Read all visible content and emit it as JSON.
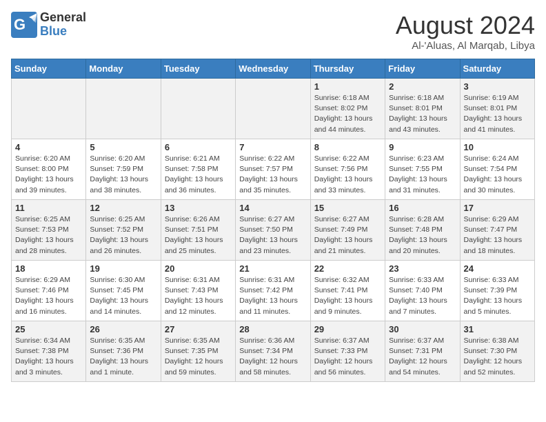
{
  "header": {
    "logo_line1": "General",
    "logo_line2": "Blue",
    "month": "August 2024",
    "location": "Al-'Aluas, Al Marqab, Libya"
  },
  "weekdays": [
    "Sunday",
    "Monday",
    "Tuesday",
    "Wednesday",
    "Thursday",
    "Friday",
    "Saturday"
  ],
  "weeks": [
    [
      {
        "day": "",
        "info": ""
      },
      {
        "day": "",
        "info": ""
      },
      {
        "day": "",
        "info": ""
      },
      {
        "day": "",
        "info": ""
      },
      {
        "day": "1",
        "info": "Sunrise: 6:18 AM\nSunset: 8:02 PM\nDaylight: 13 hours\nand 44 minutes."
      },
      {
        "day": "2",
        "info": "Sunrise: 6:18 AM\nSunset: 8:01 PM\nDaylight: 13 hours\nand 43 minutes."
      },
      {
        "day": "3",
        "info": "Sunrise: 6:19 AM\nSunset: 8:01 PM\nDaylight: 13 hours\nand 41 minutes."
      }
    ],
    [
      {
        "day": "4",
        "info": "Sunrise: 6:20 AM\nSunset: 8:00 PM\nDaylight: 13 hours\nand 39 minutes."
      },
      {
        "day": "5",
        "info": "Sunrise: 6:20 AM\nSunset: 7:59 PM\nDaylight: 13 hours\nand 38 minutes."
      },
      {
        "day": "6",
        "info": "Sunrise: 6:21 AM\nSunset: 7:58 PM\nDaylight: 13 hours\nand 36 minutes."
      },
      {
        "day": "7",
        "info": "Sunrise: 6:22 AM\nSunset: 7:57 PM\nDaylight: 13 hours\nand 35 minutes."
      },
      {
        "day": "8",
        "info": "Sunrise: 6:22 AM\nSunset: 7:56 PM\nDaylight: 13 hours\nand 33 minutes."
      },
      {
        "day": "9",
        "info": "Sunrise: 6:23 AM\nSunset: 7:55 PM\nDaylight: 13 hours\nand 31 minutes."
      },
      {
        "day": "10",
        "info": "Sunrise: 6:24 AM\nSunset: 7:54 PM\nDaylight: 13 hours\nand 30 minutes."
      }
    ],
    [
      {
        "day": "11",
        "info": "Sunrise: 6:25 AM\nSunset: 7:53 PM\nDaylight: 13 hours\nand 28 minutes."
      },
      {
        "day": "12",
        "info": "Sunrise: 6:25 AM\nSunset: 7:52 PM\nDaylight: 13 hours\nand 26 minutes."
      },
      {
        "day": "13",
        "info": "Sunrise: 6:26 AM\nSunset: 7:51 PM\nDaylight: 13 hours\nand 25 minutes."
      },
      {
        "day": "14",
        "info": "Sunrise: 6:27 AM\nSunset: 7:50 PM\nDaylight: 13 hours\nand 23 minutes."
      },
      {
        "day": "15",
        "info": "Sunrise: 6:27 AM\nSunset: 7:49 PM\nDaylight: 13 hours\nand 21 minutes."
      },
      {
        "day": "16",
        "info": "Sunrise: 6:28 AM\nSunset: 7:48 PM\nDaylight: 13 hours\nand 20 minutes."
      },
      {
        "day": "17",
        "info": "Sunrise: 6:29 AM\nSunset: 7:47 PM\nDaylight: 13 hours\nand 18 minutes."
      }
    ],
    [
      {
        "day": "18",
        "info": "Sunrise: 6:29 AM\nSunset: 7:46 PM\nDaylight: 13 hours\nand 16 minutes."
      },
      {
        "day": "19",
        "info": "Sunrise: 6:30 AM\nSunset: 7:45 PM\nDaylight: 13 hours\nand 14 minutes."
      },
      {
        "day": "20",
        "info": "Sunrise: 6:31 AM\nSunset: 7:43 PM\nDaylight: 13 hours\nand 12 minutes."
      },
      {
        "day": "21",
        "info": "Sunrise: 6:31 AM\nSunset: 7:42 PM\nDaylight: 13 hours\nand 11 minutes."
      },
      {
        "day": "22",
        "info": "Sunrise: 6:32 AM\nSunset: 7:41 PM\nDaylight: 13 hours\nand 9 minutes."
      },
      {
        "day": "23",
        "info": "Sunrise: 6:33 AM\nSunset: 7:40 PM\nDaylight: 13 hours\nand 7 minutes."
      },
      {
        "day": "24",
        "info": "Sunrise: 6:33 AM\nSunset: 7:39 PM\nDaylight: 13 hours\nand 5 minutes."
      }
    ],
    [
      {
        "day": "25",
        "info": "Sunrise: 6:34 AM\nSunset: 7:38 PM\nDaylight: 13 hours\nand 3 minutes."
      },
      {
        "day": "26",
        "info": "Sunrise: 6:35 AM\nSunset: 7:36 PM\nDaylight: 13 hours\nand 1 minute."
      },
      {
        "day": "27",
        "info": "Sunrise: 6:35 AM\nSunset: 7:35 PM\nDaylight: 12 hours\nand 59 minutes."
      },
      {
        "day": "28",
        "info": "Sunrise: 6:36 AM\nSunset: 7:34 PM\nDaylight: 12 hours\nand 58 minutes."
      },
      {
        "day": "29",
        "info": "Sunrise: 6:37 AM\nSunset: 7:33 PM\nDaylight: 12 hours\nand 56 minutes."
      },
      {
        "day": "30",
        "info": "Sunrise: 6:37 AM\nSunset: 7:31 PM\nDaylight: 12 hours\nand 54 minutes."
      },
      {
        "day": "31",
        "info": "Sunrise: 6:38 AM\nSunset: 7:30 PM\nDaylight: 12 hours\nand 52 minutes."
      }
    ]
  ]
}
